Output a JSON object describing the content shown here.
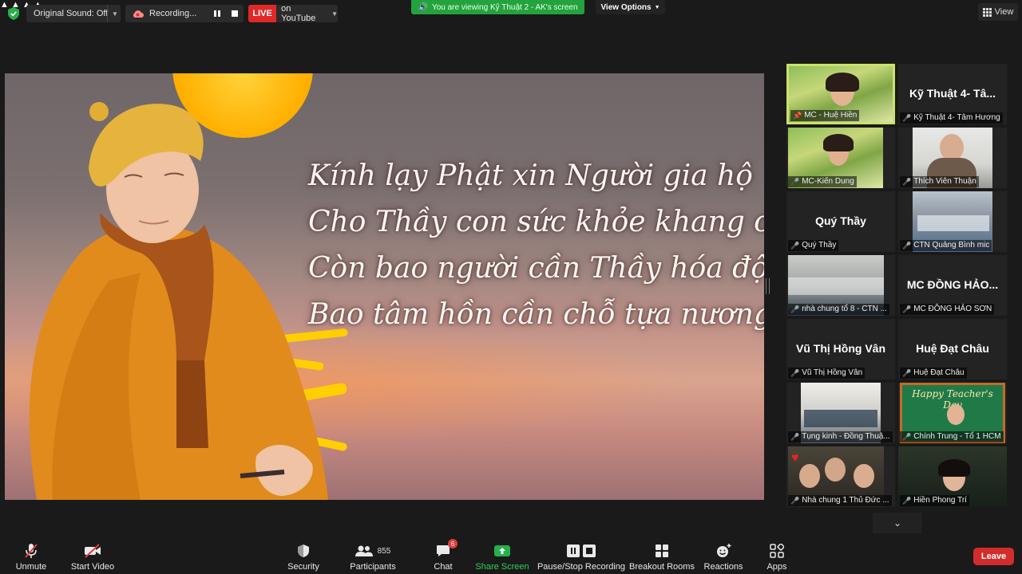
{
  "topbar": {
    "original_sound": "Original Sound: Off",
    "recording": "Recording...",
    "live_badge": "LIVE",
    "live_target": "on YouTube",
    "viewing_banner": "You are viewing Kỹ Thuật 2 - AK's screen",
    "view_options": "View Options",
    "view_button": "View"
  },
  "shared_screen": {
    "poem_lines": [
      "Kính lạy Phật xin Người gia hộ",
      "Cho Thầy con sức khỏe khang cường",
      "Còn bao người cần Thầy hóa độ",
      "Bao tâm hồn cần chỗ tựa nương"
    ]
  },
  "participants": [
    {
      "name": "MC - Huệ Hiền",
      "display": "",
      "video": "green",
      "active": true,
      "pinned": true
    },
    {
      "name": "Kỹ Thuật 4- Tâm Hương",
      "display": "Kỹ Thuật 4- Tâ...",
      "video": "none"
    },
    {
      "name": "MC-Kiến Dung",
      "display": "",
      "video": "green"
    },
    {
      "name": "Thích Viên Thuận",
      "display": "",
      "video": "room"
    },
    {
      "name": "Quý Thầy",
      "display": "Quý Thầy",
      "video": "none"
    },
    {
      "name": "CTN Quảng Bình mic",
      "display": "",
      "video": "room"
    },
    {
      "name": "nhà chung tổ 8 - CTN ...",
      "display": "",
      "video": "room"
    },
    {
      "name": "MC ĐỒNG HẢO SƠN",
      "display": "MC ĐỒNG HẢO...",
      "video": "none"
    },
    {
      "name": "Vũ Thị Hồng Vân",
      "display": "Vũ Thị Hồng Vân",
      "video": "none"
    },
    {
      "name": "Huệ Đạt Châu",
      "display": "Huệ Đạt Châu",
      "video": "none"
    },
    {
      "name": "Tụng kinh - Đồng Thuậ...",
      "display": "",
      "video": "room"
    },
    {
      "name": "Chính Trung - Tổ 1 HCM",
      "display": "",
      "video": "board",
      "board_text": "Happy Teacher's Day"
    },
    {
      "name": "Nhà chung 1 Thủ Đức ...",
      "display": "",
      "video": "dark"
    },
    {
      "name": "Hiền Phong Trí",
      "display": "",
      "video": "plant"
    }
  ],
  "toolbar": {
    "unmute": "Unmute",
    "start_video": "Start Video",
    "security": "Security",
    "participants": "Participants",
    "participants_count": "855",
    "chat": "Chat",
    "chat_count": "6",
    "share_screen": "Share Screen",
    "pause_stop_recording": "Pause/Stop Recording",
    "breakout_rooms": "Breakout Rooms",
    "reactions": "Reactions",
    "apps": "Apps",
    "leave": "Leave"
  },
  "colors": {
    "live_red": "#e02828",
    "banner_green": "#23a33d",
    "active_speaker": "#c9e36a",
    "share_green": "#2ed15a",
    "leave_red": "#d32c2c",
    "muted_mic": "#e23d3d"
  }
}
